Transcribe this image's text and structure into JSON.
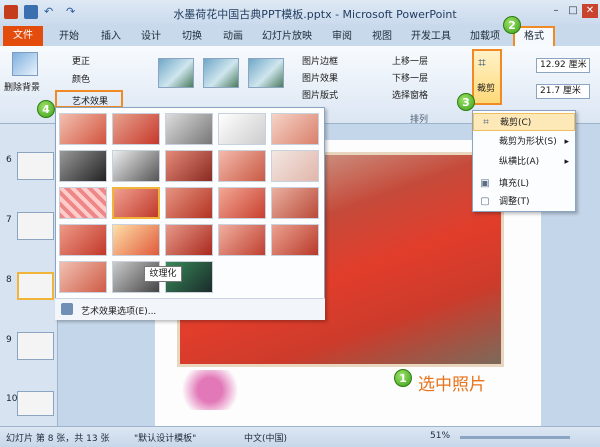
{
  "window": {
    "title": "水墨荷花中国古典PPT模板.pptx - Microsoft PowerPoint"
  },
  "tabs": [
    {
      "label": "文件"
    },
    {
      "label": "开始"
    },
    {
      "label": "插入"
    },
    {
      "label": "设计"
    },
    {
      "label": "切换"
    },
    {
      "label": "动画"
    },
    {
      "label": "幻灯片放映"
    },
    {
      "label": "审阅"
    },
    {
      "label": "视图"
    },
    {
      "label": "开发工具"
    },
    {
      "label": "加载项"
    },
    {
      "label": "格式"
    }
  ],
  "ribbon": {
    "remove_bg": "删除背景",
    "corrections": "更正",
    "color": "颜色",
    "artistic_effects": "艺术效果",
    "picture_border": "图片边框",
    "picture_effects": "图片效果",
    "picture_layout": "图片版式",
    "bring_forward": "上移一层",
    "send_backward": "下移一层",
    "selection_pane": "选择窗格",
    "arrange_group": "排列",
    "crop": "裁剪",
    "height": "12.92 厘米",
    "width": "21.7 厘米"
  },
  "gallery": {
    "tooltip": "纹理化",
    "footer": "艺术效果选项(E)..."
  },
  "crop_menu": [
    {
      "label": "裁剪(C)"
    },
    {
      "label": "裁剪为形状(S)"
    },
    {
      "label": "纵横比(A)"
    },
    {
      "label": "填充(L)"
    },
    {
      "label": "调整(T)"
    }
  ],
  "slides": [
    {
      "num": "6"
    },
    {
      "num": "7"
    },
    {
      "num": "8"
    },
    {
      "num": "9"
    },
    {
      "num": "10"
    }
  ],
  "badges": {
    "b1": "1",
    "b2": "2",
    "b3": "3",
    "b4": "4"
  },
  "caption": "选中照片",
  "status": {
    "slide_info": "幻灯片 第 8 张，共 13 张",
    "theme": "\"默认设计模板\"",
    "language": "中文(中国)",
    "zoom": "51%"
  },
  "colors": {
    "file_tab": "#e34c0c",
    "highlight": "#f08a24",
    "badge": "#3c9f1a"
  }
}
